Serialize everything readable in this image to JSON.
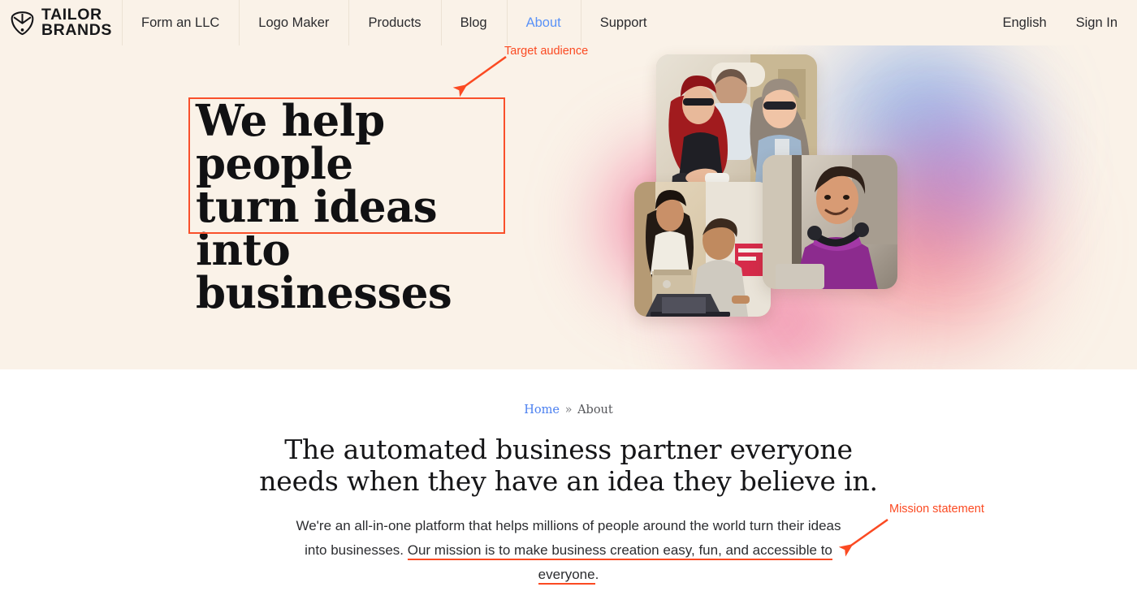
{
  "header": {
    "logo": {
      "icon": "tailor-brands-shield-icon",
      "line1": "TAILOR",
      "line2": "BRANDS"
    },
    "nav": [
      {
        "label": "Form an LLC",
        "active": false
      },
      {
        "label": "Logo Maker",
        "active": false
      },
      {
        "label": "Products",
        "active": false
      },
      {
        "label": "Blog",
        "active": false
      },
      {
        "label": "About",
        "active": true
      },
      {
        "label": "Support",
        "active": false
      }
    ],
    "right": [
      {
        "label": "English"
      },
      {
        "label": "Sign In"
      }
    ]
  },
  "hero": {
    "headline_line1": "We help people",
    "headline_line2": "turn ideas into",
    "headline_line3": "businesses",
    "photos": [
      {
        "name": "photo-two-women-smiling-outdoors"
      },
      {
        "name": "photo-man-purple-shirt-headphones"
      },
      {
        "name": "photo-two-people-at-laptop"
      }
    ]
  },
  "annotations": [
    {
      "id": "target-audience",
      "label": "Target audience"
    },
    {
      "id": "mission-statement",
      "label": "Mission statement"
    }
  ],
  "main": {
    "breadcrumb": {
      "home": "Home",
      "separator": "»",
      "current": "About"
    },
    "title_line1": "The automated business partner everyone",
    "title_line2": "needs when they have an idea they believe in.",
    "body_before": "We're an all-in-one platform that helps millions of people around the world turn their ideas into businesses. ",
    "body_highlight": "Our mission is to make business creation easy, fun, and accessible to everyone",
    "body_after": "."
  },
  "colors": {
    "hero_bg": "#faf2e8",
    "page_bg": "#ffffff",
    "accent_annotation": "#fb4a22",
    "link_blue": "#4a7ff0",
    "nav_active_blue": "#5a92f7",
    "text_dark": "#151517"
  }
}
